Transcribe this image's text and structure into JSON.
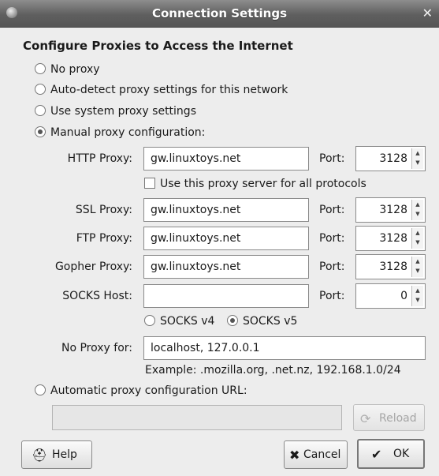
{
  "window": {
    "title": "Connection Settings"
  },
  "heading": "Configure Proxies to Access the Internet",
  "modes": {
    "no_proxy": "No proxy",
    "auto_detect": "Auto-detect proxy settings for this network",
    "system": "Use system proxy settings",
    "manual": "Manual proxy configuration:",
    "auto_url": "Automatic proxy configuration URL:",
    "selected": "manual"
  },
  "http": {
    "label": "HTTP Proxy:",
    "value": "gw.linuxtoys.net",
    "port_label": "Port:",
    "port": "3128"
  },
  "same_for_all": "Use this proxy server for all protocols",
  "ssl": {
    "label": "SSL Proxy:",
    "value": "gw.linuxtoys.net",
    "port_label": "Port:",
    "port": "3128"
  },
  "ftp": {
    "label": "FTP Proxy:",
    "value": "gw.linuxtoys.net",
    "port_label": "Port:",
    "port": "3128"
  },
  "gopher": {
    "label": "Gopher Proxy:",
    "value": "gw.linuxtoys.net",
    "port_label": "Port:",
    "port": "3128"
  },
  "socks": {
    "label": "SOCKS Host:",
    "value": "",
    "port_label": "Port:",
    "port": "0",
    "v4": "SOCKS v4",
    "v5": "SOCKS v5",
    "version_selected": "v5"
  },
  "no_proxy_for": {
    "label": "No Proxy for:",
    "value": "localhost, 127.0.0.1"
  },
  "example": "Example: .mozilla.org, .net.nz, 192.168.1.0/24",
  "auto_url_value": "",
  "buttons": {
    "reload": "Reload",
    "help": "Help",
    "cancel": "Cancel",
    "ok": "OK"
  },
  "icons": {
    "close": "close-icon",
    "help": "help-icon",
    "cancel": "x-icon",
    "ok": "ok-icon",
    "reload": "reload-icon"
  }
}
